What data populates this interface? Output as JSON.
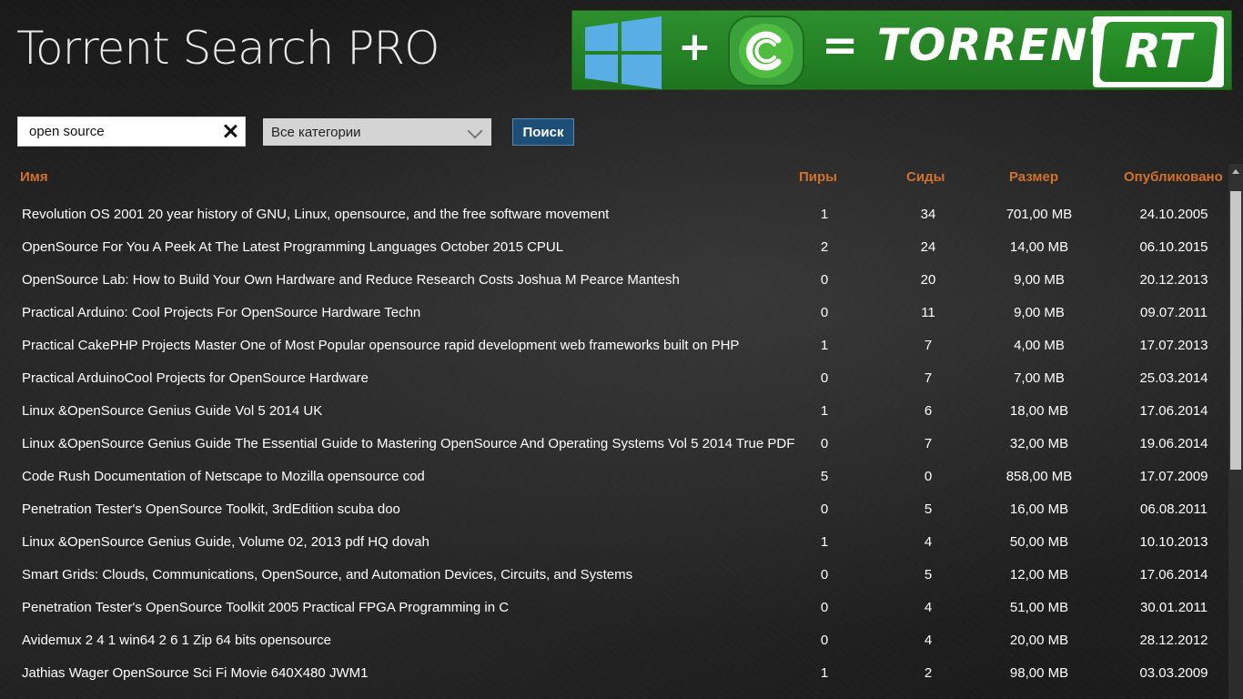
{
  "app": {
    "title": "Torrent Search PRO"
  },
  "banner": {
    "plus": "+",
    "text": "= TORRENT",
    "badge": "RT",
    "colors": {
      "background": "#248224",
      "windows_logo": "#5aaee6"
    }
  },
  "search": {
    "value": "open source",
    "placeholder": ""
  },
  "category": {
    "selected": "Все категории"
  },
  "search_button": {
    "label": "Поиск"
  },
  "table": {
    "headers": {
      "name": "Имя",
      "peers": "Пиры",
      "seeds": "Сиды",
      "size": "Размер",
      "published": "Опубликовано"
    },
    "rows": [
      {
        "name": "Revolution OS 2001 20 year history of GNU, Linux, opensource, and the free software movement",
        "peers": "1",
        "seeds": "34",
        "size": "701,00 MB",
        "published": "24.10.2005"
      },
      {
        "name": "OpenSource For You A Peek At The Latest Programming Languages October 2015 CPUL",
        "peers": "2",
        "seeds": "24",
        "size": "14,00 MB",
        "published": "06.10.2015"
      },
      {
        "name": "OpenSource Lab: How to Build Your Own Hardware and Reduce Research Costs Joshua M Pearce Mantesh",
        "peers": "0",
        "seeds": "20",
        "size": "9,00 MB",
        "published": "20.12.2013"
      },
      {
        "name": "Practical Arduino: Cool Projects For OpenSource Hardware Techn",
        "peers": "0",
        "seeds": "11",
        "size": "9,00 MB",
        "published": "09.07.2011"
      },
      {
        "name": "Practical CakePHP Projects Master One of Most Popular opensource rapid development web frameworks built on PHP",
        "peers": "1",
        "seeds": "7",
        "size": "4,00 MB",
        "published": "17.07.2013"
      },
      {
        "name": "Practical ArduinoCool Projects for OpenSource Hardware",
        "peers": "0",
        "seeds": "7",
        "size": "7,00 MB",
        "published": "25.03.2014"
      },
      {
        "name": "Linux &OpenSource Genius Guide Vol 5 2014 UK",
        "peers": "1",
        "seeds": "6",
        "size": "18,00 MB",
        "published": "17.06.2014"
      },
      {
        "name": "Linux &OpenSource Genius Guide The Essential Guide to Mastering OpenSource And Operating Systems Vol 5 2014 True PDF",
        "peers": "0",
        "seeds": "7",
        "size": "32,00 MB",
        "published": "19.06.2014"
      },
      {
        "name": "Code Rush Documentation of Netscape to Mozilla opensource cod",
        "peers": "5",
        "seeds": "0",
        "size": "858,00 MB",
        "published": "17.07.2009"
      },
      {
        "name": "Penetration Tester's OpenSource Toolkit, 3rdEdition scuba doo",
        "peers": "0",
        "seeds": "5",
        "size": "16,00 MB",
        "published": "06.08.2011"
      },
      {
        "name": "Linux &OpenSource Genius Guide, Volume 02, 2013 pdf HQ dovah",
        "peers": "1",
        "seeds": "4",
        "size": "50,00 MB",
        "published": "10.10.2013"
      },
      {
        "name": "Smart Grids: Clouds, Communications, OpenSource, and Automation Devices, Circuits, and Systems",
        "peers": "0",
        "seeds": "5",
        "size": "12,00 MB",
        "published": "17.06.2014"
      },
      {
        "name": "Penetration Tester's OpenSource Toolkit 2005 Practical FPGA Programming in C",
        "peers": "0",
        "seeds": "4",
        "size": "51,00 MB",
        "published": "30.01.2011"
      },
      {
        "name": "Avidemux 2 4 1 win64 2 6 1 Zip 64 bits opensource",
        "peers": "0",
        "seeds": "4",
        "size": "20,00 MB",
        "published": "28.12.2012"
      },
      {
        "name": "Jathias Wager OpenSource Sci Fi Movie 640X480 JWM1",
        "peers": "1",
        "seeds": "2",
        "size": "98,00 MB",
        "published": "03.03.2009"
      }
    ]
  },
  "colors": {
    "header_text": "#d2712a",
    "button_bg": "#1d4e78",
    "accent": "#2f8f2f"
  }
}
